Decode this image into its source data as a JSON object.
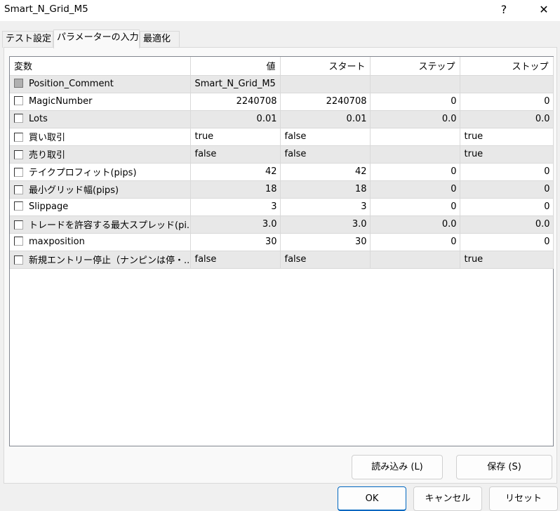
{
  "window": {
    "title": "Smart_N_Grid_M5",
    "help_label": "?",
    "close_label": "✕"
  },
  "tabs": [
    {
      "label": "テスト設定"
    },
    {
      "label": "パラメーターの入力",
      "active": true
    },
    {
      "label": "最適化"
    }
  ],
  "table": {
    "headers": [
      "変数",
      "値",
      "スタート",
      "ステップ",
      "ストップ"
    ],
    "rows": [
      {
        "name": "Position_Comment",
        "value": "Smart_N_Grid_M5",
        "start": "",
        "step": "",
        "stop": "",
        "checked": false,
        "disabled": true,
        "align": "left"
      },
      {
        "name": "MagicNumber",
        "value": "2240708",
        "start": "2240708",
        "step": "0",
        "stop": "0",
        "checked": false,
        "align": "right"
      },
      {
        "name": "Lots",
        "value": "0.01",
        "start": "0.01",
        "step": "0.0",
        "stop": "0.0",
        "checked": false,
        "align": "right"
      },
      {
        "name": "買い取引",
        "value": "true",
        "start": "false",
        "step": "",
        "stop": "true",
        "checked": false,
        "align": "left"
      },
      {
        "name": "売り取引",
        "value": "false",
        "start": "false",
        "step": "",
        "stop": "true",
        "checked": false,
        "align": "left"
      },
      {
        "name": "テイクプロフィット(pips)",
        "value": "42",
        "start": "42",
        "step": "0",
        "stop": "0",
        "checked": false,
        "align": "right"
      },
      {
        "name": "最小グリッド幅(pips)",
        "value": "18",
        "start": "18",
        "step": "0",
        "stop": "0",
        "checked": false,
        "align": "right"
      },
      {
        "name": "Slippage",
        "value": "3",
        "start": "3",
        "step": "0",
        "stop": "0",
        "checked": false,
        "align": "right"
      },
      {
        "name": "トレードを許容する最大スプレッド(pi...",
        "value": "3.0",
        "start": "3.0",
        "step": "0.0",
        "stop": "0.0",
        "checked": false,
        "align": "right"
      },
      {
        "name": "maxposition",
        "value": "30",
        "start": "30",
        "step": "0",
        "stop": "0",
        "checked": false,
        "align": "right"
      },
      {
        "name": "新規エントリー停止（ナンピンは停・..",
        "value": "false",
        "start": "false",
        "step": "",
        "stop": "true",
        "checked": false,
        "align": "left"
      }
    ]
  },
  "buttons": {
    "load": "読み込み (L)",
    "save": "保存 (S)",
    "ok": "OK",
    "cancel": "キャンセル",
    "reset": "リセット"
  }
}
